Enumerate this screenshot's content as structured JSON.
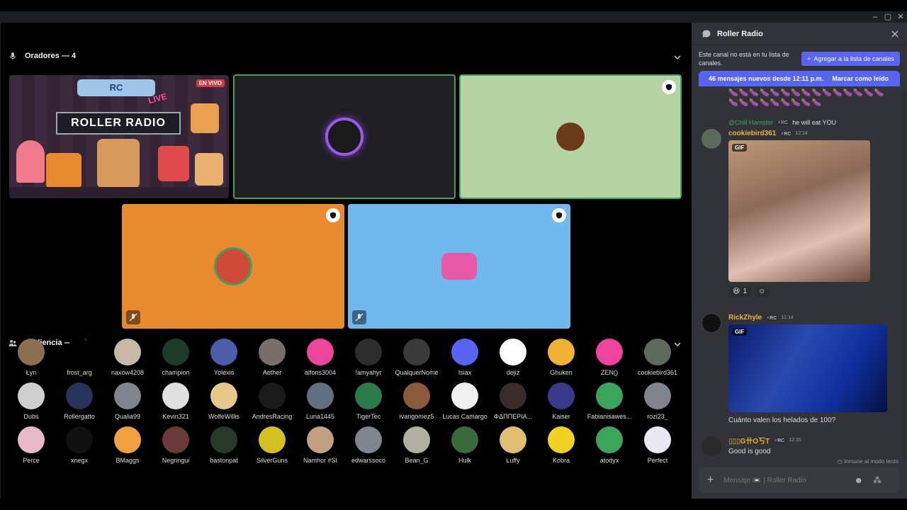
{
  "window": {
    "controls": [
      "–",
      "▢",
      "✕"
    ]
  },
  "stage": {
    "speakers_title": "Oradores — 4",
    "audience_title": "Audiencia — 114",
    "live_badge": "EN VIVO",
    "banner_top": "RC",
    "banner_live": "LIVE",
    "banner_title": "ROLLER RADIO",
    "tile_colors": [
      "#1f1f24",
      "#b5d3a3",
      "#e98a2f",
      "#6fb9ef"
    ]
  },
  "audience": [
    {
      "name": "Łyn",
      "color": "#8b6f4e"
    },
    {
      "name": "frost_arg",
      "color": "#000000"
    },
    {
      "name": "naxow4208",
      "color": "#c8b8a8"
    },
    {
      "name": "champion",
      "color": "#1e3b2a"
    },
    {
      "name": "Yolexis",
      "color": "#4b5da8"
    },
    {
      "name": "Aether",
      "color": "#7a6f68"
    },
    {
      "name": "alfons3004",
      "color": "#eb459e"
    },
    {
      "name": "!amyahyr",
      "color": "#2d2d2d"
    },
    {
      "name": "QualquerNome",
      "color": "#3a3a3a"
    },
    {
      "name": "Isiax",
      "color": "#5865f2"
    },
    {
      "name": "dejiz",
      "color": "#ffffff"
    },
    {
      "name": "Ghuken",
      "color": "#f0b232"
    },
    {
      "name": "ZEN()",
      "color": "#eb459e"
    },
    {
      "name": "cookiebird361",
      "color": "#5b6a5a"
    },
    {
      "name": "Dubs",
      "color": "#cfcfcf"
    },
    {
      "name": "Rollergatto",
      "color": "#26335a"
    },
    {
      "name": "Qualia99",
      "color": "#80848e"
    },
    {
      "name": "Kevin321",
      "color": "#e0e0e0"
    },
    {
      "name": "WolfeWillis",
      "color": "#e6c88a"
    },
    {
      "name": "AndresRacing",
      "color": "#1a1a1a"
    },
    {
      "name": "Luna1445",
      "color": "#607080"
    },
    {
      "name": "TigerTec",
      "color": "#2a7a4a"
    },
    {
      "name": "ivangomez5",
      "color": "#8a5a3a"
    },
    {
      "name": "Lucas Camargo",
      "color": "#f0f0f0"
    },
    {
      "name": "ΦΔΠΠΕΡΙΑ...",
      "color": "#3a2a2a"
    },
    {
      "name": "Kaiser",
      "color": "#3a3a8a"
    },
    {
      "name": "Fabianisawes...",
      "color": "#3ba55c"
    },
    {
      "name": "rozi23_",
      "color": "#80848e"
    },
    {
      "name": "Perce",
      "color": "#e8b8c8"
    },
    {
      "name": "xnegx",
      "color": "#111111"
    },
    {
      "name": "BMaggs",
      "color": "#f0a040"
    },
    {
      "name": "Negringui",
      "color": "#6a3a3a"
    },
    {
      "name": "bastonpat",
      "color": "#2a3a2a"
    },
    {
      "name": "SilverGuns",
      "color": "#d4c020"
    },
    {
      "name": "Namhor #SI",
      "color": "#c0a080"
    },
    {
      "name": "edwarssoco",
      "color": "#80848e"
    },
    {
      "name": "Bean_G",
      "color": "#b0b0a0"
    },
    {
      "name": "Hulk",
      "color": "#3a6a3a"
    },
    {
      "name": "Luffy",
      "color": "#e0c070"
    },
    {
      "name": "Kobra",
      "color": "#f0d020"
    },
    {
      "name": "atodyx",
      "color": "#3ba55c"
    },
    {
      "name": "Perfect",
      "color": "#e8e8f0"
    }
  ],
  "chat": {
    "channel": "Roller Radio",
    "notice": "Este canal no está en tu lista de canales.",
    "add_button": "Agregar a la lista de canales",
    "new_messages": "46 mensajes nuevos desde 12:11 p.m.",
    "mark_read": "Marcar como leído",
    "eggplants": "🍆🍆🍆🍆🍆🍆🍆🍆🍆🍆🍆🍆🍆🍆🍆🍆🍆🍆🍆🍆🍆🍆🍆🍆",
    "messages": [
      {
        "reply_to": "@Chill Hamster",
        "reply_tag": "⚡RC",
        "reply_text": "he will eat YOU",
        "user": "cookiebird361",
        "user_color": "#f0b232",
        "tag": "⚡RC",
        "time": "12:14",
        "gif_label": "GIF",
        "reaction_count": "1"
      },
      {
        "user": "RickZhyle",
        "user_color": "#f0b232",
        "tag": "⚡RC",
        "time": "12:14",
        "gif_label": "GIF",
        "text": "Cuánto valen los helados de 100?"
      },
      {
        "user": "▯▯▯G卄O丂T",
        "user_color": "#f0b232",
        "tag": "⚡RC",
        "time": "12:15",
        "text": "Good is good"
      }
    ],
    "slowmode": "Inmune al modo lento",
    "composer_placeholder": "Mensaje 📼 | Roller Radio"
  }
}
